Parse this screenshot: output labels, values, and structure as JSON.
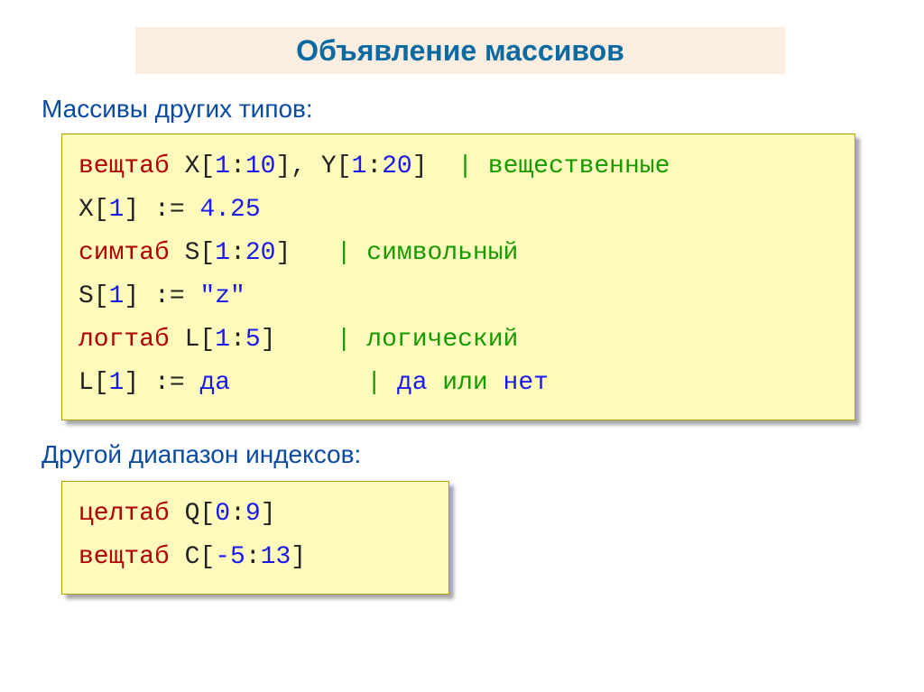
{
  "title": "Объявление массивов",
  "sub1": "Массивы других типов:",
  "sub2": "Другой диапазон индексов:",
  "box1": {
    "l1": {
      "kw": "вещтаб",
      "mid1": " X[",
      "n1": "1",
      "c1": ":",
      "n2": "10",
      "mid2": "], Y[",
      "n3": "1",
      "c2": ":",
      "n4": "20",
      "mid3": "]  ",
      "cmt": "| вещественные"
    },
    "l2": {
      "pre": "X[",
      "n1": "1",
      "mid": "] := ",
      "val": "4.25"
    },
    "l3": {
      "kw": "симтаб",
      "mid1": " S[",
      "n1": "1",
      "c1": ":",
      "n2": "20",
      "mid2": "]   ",
      "cmt": "| символьный"
    },
    "l4": {
      "pre": "S[",
      "n1": "1",
      "mid": "] := ",
      "val": "\"z\""
    },
    "l5": {
      "kw": "логтаб",
      "mid1": " L[",
      "n1": "1",
      "c1": ":",
      "n2": "5",
      "mid2": "]    ",
      "cmt": "| логический"
    },
    "l6": {
      "pre": "L[",
      "n1": "1",
      "mid": "] := ",
      "val": "да",
      "pad": "         ",
      "cpre": "| ",
      "da": "да",
      "ili": " или ",
      "net": "нет"
    }
  },
  "box2": {
    "l1": {
      "kw": "целтаб",
      "mid1": " Q[",
      "n1": "0",
      "c1": ":",
      "n2": "9",
      "mid2": "]"
    },
    "l2": {
      "kw": "вещтаб",
      "mid1": " C[",
      "n1": "-5",
      "c1": ":",
      "n2": "13",
      "mid2": "]"
    }
  }
}
